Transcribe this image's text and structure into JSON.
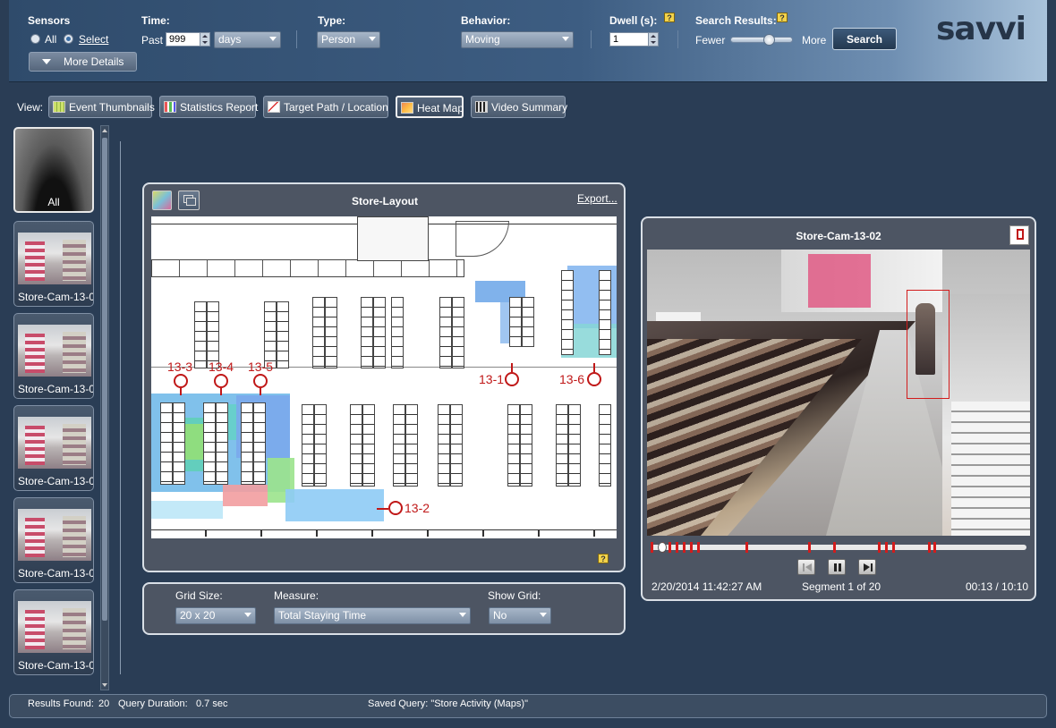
{
  "top": {
    "sensors": {
      "label": "Sensors",
      "all_label": "All",
      "select_label": "Select"
    },
    "more_details_label": "More Details",
    "time": {
      "label": "Time:",
      "past_label": "Past",
      "value": "999",
      "unit": "days"
    },
    "type": {
      "label": "Type:",
      "value": "Person"
    },
    "behavior": {
      "label": "Behavior:",
      "value": "Moving"
    },
    "dwell": {
      "label": "Dwell (s):",
      "value": "1"
    },
    "search_results": {
      "label": "Search Results:",
      "fewer": "Fewer",
      "more": "More",
      "slider_level": 0.6
    },
    "search_label": "Search",
    "logo": "savvi"
  },
  "view": {
    "label": "View:",
    "buttons": [
      {
        "label": "Event Thumbnails",
        "active": false
      },
      {
        "label": "Statistics Report",
        "active": false
      },
      {
        "label": "Target Path / Location",
        "active": false
      },
      {
        "label": "Heat Map",
        "active": true
      },
      {
        "label": "Video Summary",
        "active": false
      }
    ]
  },
  "thumbs": [
    {
      "name": "All"
    },
    {
      "name": "Store-Cam-13-0"
    },
    {
      "name": "Store-Cam-13-0"
    },
    {
      "name": "Store-Cam-13-0"
    },
    {
      "name": "Store-Cam-13-0"
    },
    {
      "name": "Store-Cam-13-0"
    }
  ],
  "map_panel": {
    "title": "Store-Layout",
    "export_label": "Export...",
    "markers": [
      {
        "label": "13-3"
      },
      {
        "label": "13-4"
      },
      {
        "label": "13-5"
      },
      {
        "label": "13-1"
      },
      {
        "label": "13-6"
      },
      {
        "label": "13-2"
      }
    ]
  },
  "grid_panel": {
    "grid_size": {
      "label": "Grid Size:",
      "value": "20 x 20"
    },
    "measure": {
      "label": "Measure:",
      "value": "Total Staying Time"
    },
    "show_grid": {
      "label": "Show Grid:",
      "value": "No"
    }
  },
  "video_panel": {
    "title": "Store-Cam-13-02",
    "timestamp": "2/20/2014 11:42:27 AM",
    "segment": "Segment 1 of 20",
    "time": "00:13 / 10:10",
    "progress": 0.02
  },
  "status": {
    "results_label": "Results Found:",
    "results_value": "20",
    "duration_label": "Query Duration:",
    "duration_value": "0.7 sec",
    "saved_query": "Saved Query: \"Store Activity (Maps)\""
  },
  "colors": {
    "accent": "#3d5d82",
    "marker": "#c01818",
    "heat_blue": "#5b9be0",
    "heat_green": "#8fe07a"
  }
}
